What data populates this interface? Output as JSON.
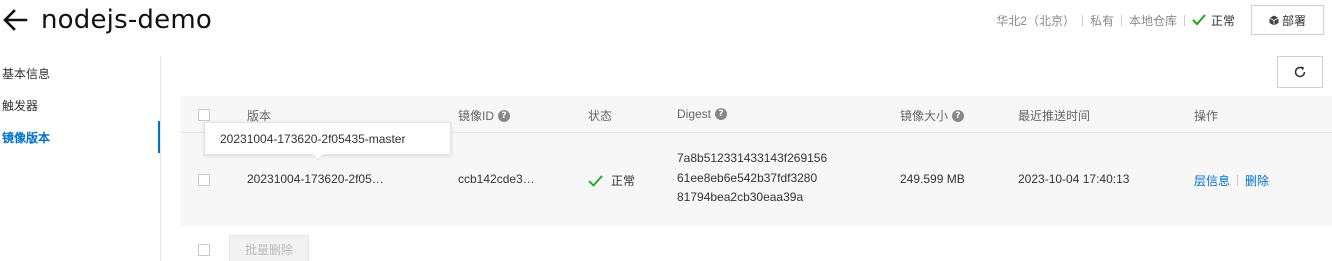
{
  "header": {
    "title": "nodejs-demo",
    "region": "华北2（北京）",
    "visibility": "私有",
    "repo_type": "本地仓库",
    "status": "正常",
    "deploy_label": "部署"
  },
  "sidebar": {
    "items": [
      {
        "label": "基本信息",
        "active": false
      },
      {
        "label": "触发器",
        "active": false
      },
      {
        "label": "镜像版本",
        "active": true
      }
    ]
  },
  "table": {
    "columns": {
      "version": "版本",
      "image_id": "镜像ID",
      "status": "状态",
      "digest": "Digest",
      "size": "镜像大小",
      "last_push": "最近推送时间",
      "actions": "操作"
    },
    "rows": [
      {
        "version": "20231004-173620-2f05…",
        "version_full": "20231004-173620-2f05435-master",
        "image_id": "ccb142cde3…",
        "status": "正常",
        "digest_lines": [
          "7a8b512331433143f269156",
          "61ee8eb6e542b37fdf3280",
          "81794bea2cb30eaa39a"
        ],
        "size": "249.599 MB",
        "last_push": "2023-10-04 17:40:13",
        "action_layers": "层信息",
        "action_delete": "删除"
      }
    ]
  },
  "batch_delete_label": "批量删除",
  "colors": {
    "accent": "#0070cc",
    "success": "#1aa81a",
    "table_bg": "#f7f7f7"
  },
  "icons": {
    "back": "arrow-left-icon",
    "status_ok": "check-icon",
    "deploy": "cube-icon",
    "refresh": "refresh-icon",
    "help": "question-circle-icon"
  }
}
